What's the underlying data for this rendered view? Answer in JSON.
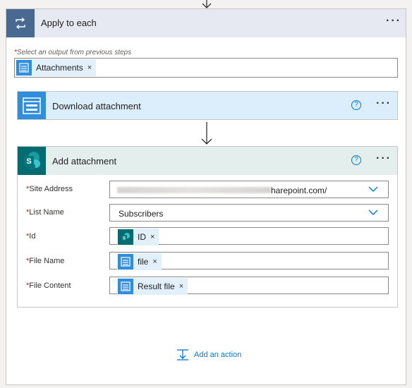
{
  "loop": {
    "title": "Apply to each",
    "more": "···",
    "output_label": "Select an output from previous steps",
    "output_token": "Attachments"
  },
  "download": {
    "title": "Download attachment",
    "help": "?",
    "more": "···"
  },
  "attach": {
    "title": "Add attachment",
    "help": "?",
    "more": "···",
    "sharepoint_letter": "S",
    "fields": {
      "site_address": {
        "label": "Site Address",
        "value_tail": "harepoint.com/"
      },
      "list_name": {
        "label": "List Name",
        "value": "Subscribers"
      },
      "id": {
        "label": "Id",
        "token": "ID"
      },
      "file_name": {
        "label": "File Name",
        "token": "file"
      },
      "file_content": {
        "label": "File Content",
        "token": "Result file"
      }
    }
  },
  "footer": {
    "add_action": "Add an action"
  },
  "required_mark": "*",
  "remove_glyph": "×",
  "icons": {
    "loop": "loop-arrows-icon",
    "download": "form-table-icon",
    "sharepoint": "sharepoint-icon",
    "chevron": "chevron-down-icon",
    "add_action": "insert-step-icon"
  },
  "colors": {
    "loop_header": "#e6e9f2",
    "loop_icon_bg": "#486991",
    "download_header": "#dceefb",
    "download_icon_bg": "#2f8fde",
    "attach_header": "#e4efed",
    "sharepoint_bg": "#036c70",
    "token_bg": "#e1f0fb",
    "link": "#0078d4",
    "required": "#a4262c"
  }
}
